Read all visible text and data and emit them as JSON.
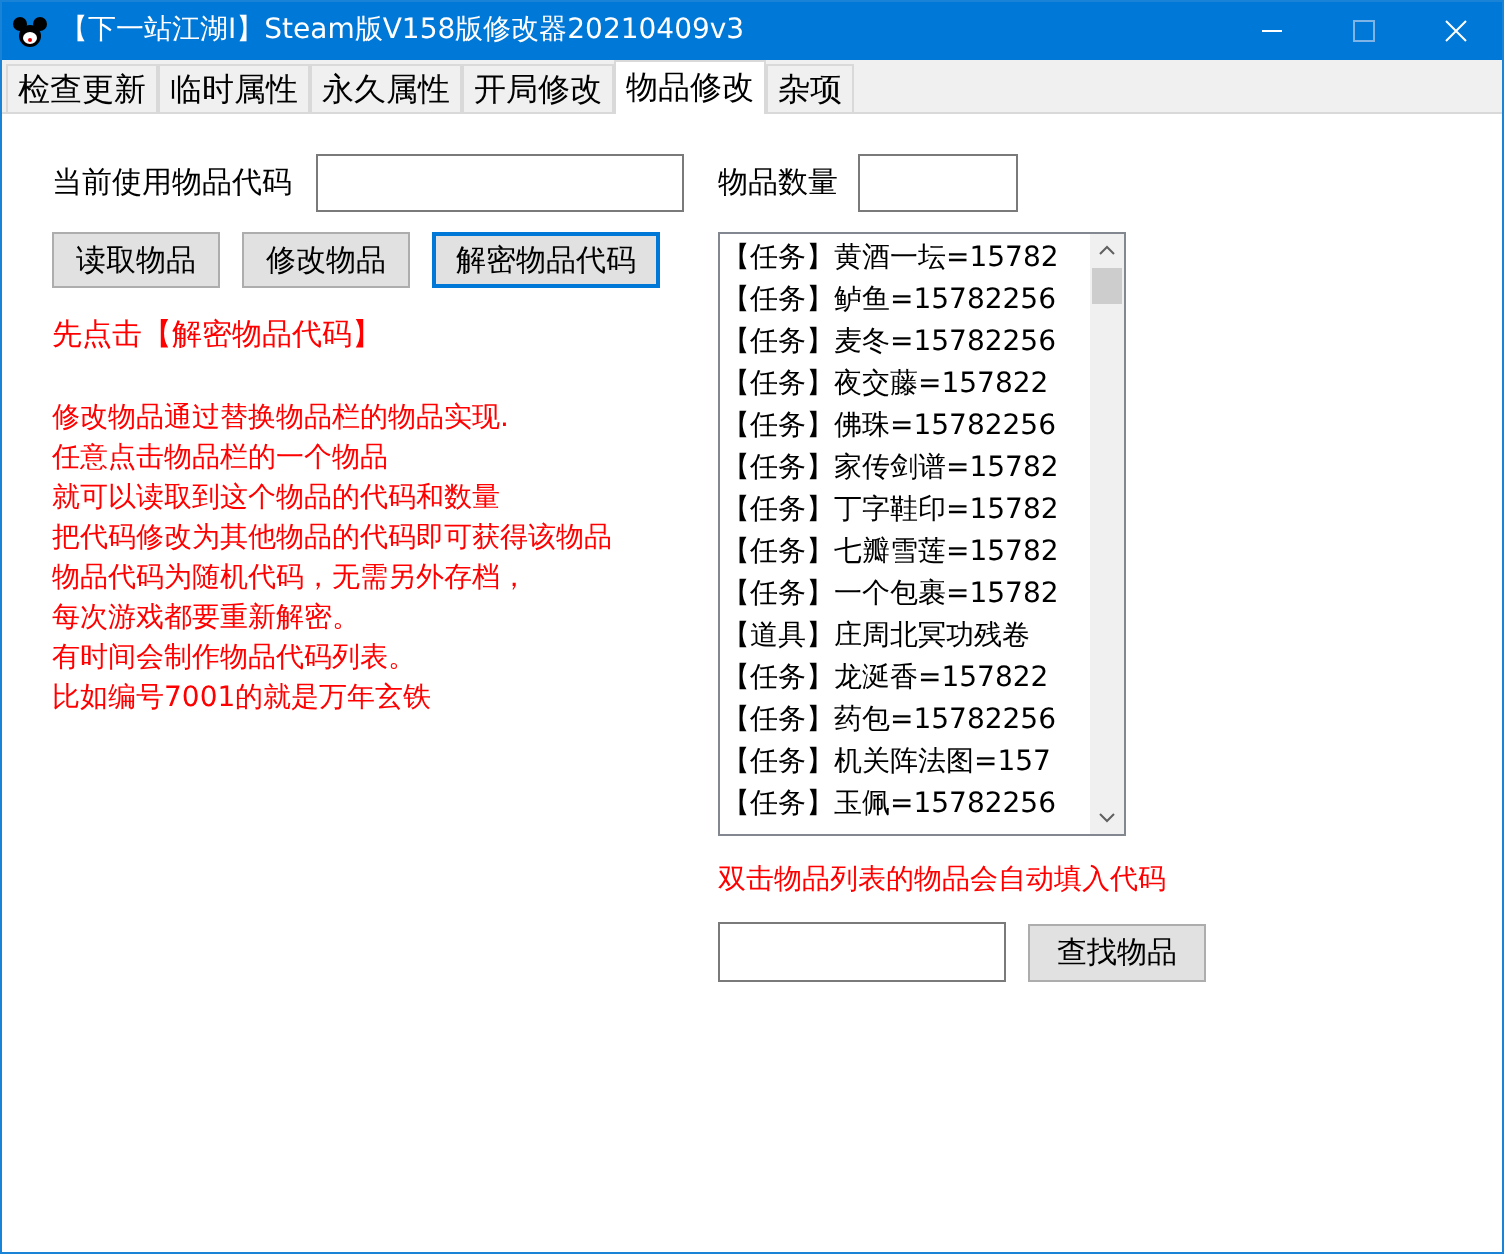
{
  "window": {
    "title": "【下一站江湖I】Steam版V158版修改器20210409v3"
  },
  "tabs": [
    {
      "label": "检查更新",
      "selected": false
    },
    {
      "label": "临时属性",
      "selected": false
    },
    {
      "label": "永久属性",
      "selected": false
    },
    {
      "label": "开局修改",
      "selected": false
    },
    {
      "label": "物品修改",
      "selected": true
    },
    {
      "label": "杂项",
      "selected": false
    }
  ],
  "code_label": "当前使用物品代码",
  "qty_label": "物品数量",
  "buttons": [
    {
      "label": "读取物品",
      "focused": false
    },
    {
      "label": "修改物品",
      "focused": false
    },
    {
      "label": "解密物品代码",
      "focused": true
    }
  ],
  "hint": "先点击【解密物品代码】",
  "notes": [
    "修改物品通过替换物品栏的物品实现.",
    "任意点击物品栏的一个物品",
    "就可以读取到这个物品的代码和数量",
    "把代码修改为其他物品的代码即可获得该物品",
    "物品代码为随机代码，无需另外存档，",
    "每次游戏都要重新解密。",
    "有时间会制作物品代码列表。",
    "比如编号7001的就是万年玄铁"
  ],
  "items": [
    "【任务】黄酒一坛=15782",
    "【任务】鲈鱼=15782256",
    "【任务】麦冬=15782256",
    "【任务】夜交藤=157822",
    "【任务】佛珠=15782256",
    "【任务】家传剑谱=15782",
    "【任务】丁字鞋印=15782",
    "【任务】七瓣雪莲=15782",
    "【任务】一个包裹=15782",
    "【道具】庄周北冥功残卷",
    "【任务】龙涎香=157822",
    "【任务】药包=15782256",
    "【任务】机关阵法图=157",
    "【任务】玉佩=15782256"
  ],
  "list_hint": "双击物品列表的物品会自动填入代码",
  "find_button": "查找物品"
}
